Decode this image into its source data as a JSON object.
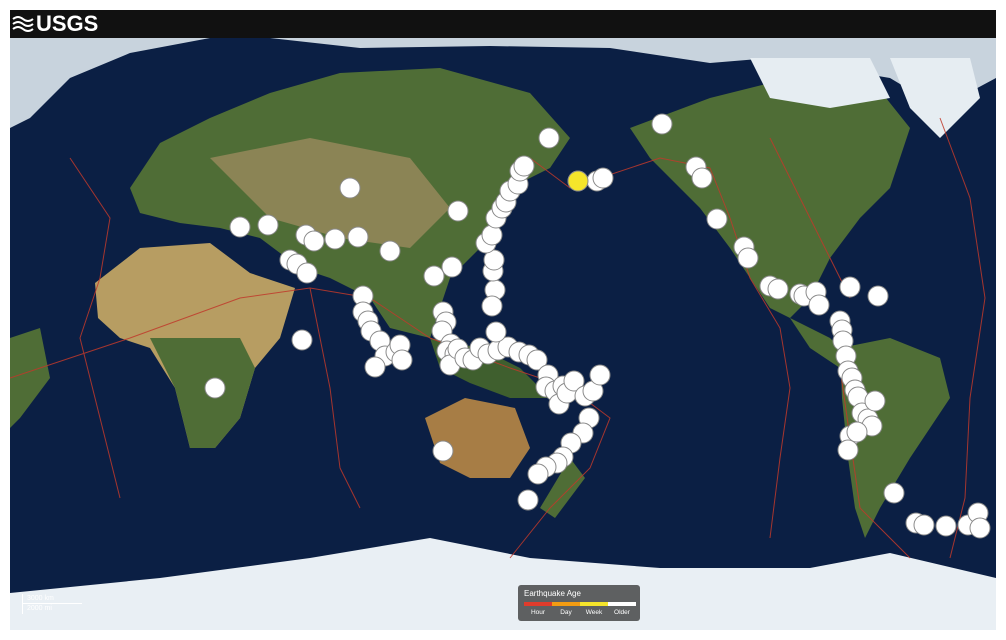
{
  "header": {
    "logo_text": "USGS"
  },
  "map": {
    "ocean_color": "#0b1f44",
    "land_color": "#4b6b34",
    "ice_color": "#e8eef3",
    "plate_boundary_color": "#c0392b"
  },
  "scale": {
    "km_label": "3000 km",
    "mi_label": "2000 mi"
  },
  "legend": {
    "title": "Earthquake Age",
    "items": [
      {
        "label": "Hour",
        "color": "#e03c2c"
      },
      {
        "label": "Day",
        "color": "#f39c12"
      },
      {
        "label": "Week",
        "color": "#f5e52b"
      },
      {
        "label": "Older",
        "color": "#ffffff"
      }
    ]
  }
}
